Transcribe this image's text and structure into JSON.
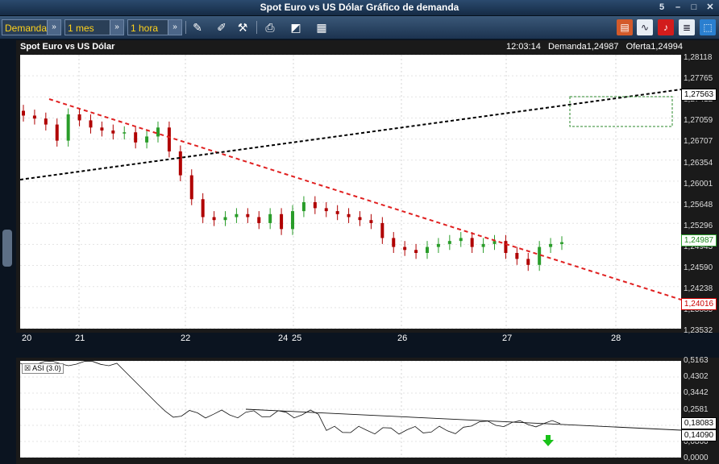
{
  "window": {
    "title": "Spot Euro vs US Dólar Gráfico de demanda",
    "controls": [
      "5",
      "–",
      "□",
      "✕"
    ]
  },
  "toolbar": {
    "price_select": "Demanda",
    "period_select": "1 mes",
    "interval_select": "1 hora"
  },
  "chart_header": {
    "title": "Spot Euro vs US Dólar",
    "time": "12:03:14",
    "bid_label": "Demanda",
    "bid": "1,24987",
    "ask_label": "Oferta",
    "ask": "1,24994"
  },
  "colors": {
    "up": "#2a9d2a",
    "down": "#b00000",
    "trend_red": "#e02020",
    "trend_black": "#000000",
    "zone_green": "#2b8a2b"
  },
  "price_axis": [
    "1,28118",
    "1,27765",
    "1,27412",
    "1,27059",
    "1,26707",
    "1,26354",
    "1,26001",
    "1,25648",
    "1,25296",
    "1,24943",
    "1,24590",
    "1,24238",
    "1,23885",
    "1,23532"
  ],
  "price_badges": {
    "black_line": "1,27563",
    "current": "1,24987",
    "red_line": "1,24016"
  },
  "x_axis": [
    "20",
    "21",
    "22",
    "24",
    "25",
    "26",
    "27",
    "28"
  ],
  "indicator": {
    "label": "ASI (3.0)",
    "axis": [
      "0,5163",
      "0,4302",
      "0,3442",
      "0,2581",
      "0,1721",
      "0,0860",
      "0,0000"
    ],
    "badges": [
      "0,18083",
      "0,14090"
    ]
  },
  "chart_data": {
    "type": "candlestick",
    "title": "Spot Euro vs US Dólar",
    "ylim": [
      1.23532,
      1.28118
    ],
    "x": [
      "20",
      "20",
      "20",
      "20",
      "20",
      "21",
      "21",
      "21",
      "21",
      "21",
      "21",
      "21",
      "21",
      "21",
      "21",
      "21",
      "22",
      "22",
      "22",
      "22",
      "22",
      "22",
      "22",
      "22",
      "22",
      "22",
      "24",
      "24",
      "24",
      "25",
      "25",
      "25",
      "25",
      "25",
      "25",
      "25",
      "26",
      "26",
      "26",
      "26",
      "26",
      "26",
      "26",
      "27",
      "27",
      "27",
      "27",
      "27",
      "27"
    ],
    "close": [
      1.271,
      1.2705,
      1.2695,
      1.2668,
      1.2712,
      1.2702,
      1.269,
      1.2685,
      1.268,
      1.2682,
      1.2665,
      1.2675,
      1.269,
      1.265,
      1.261,
      1.257,
      1.254,
      1.2535,
      1.254,
      1.2545,
      1.254,
      1.253,
      1.2545,
      1.252,
      1.255,
      1.2565,
      1.2555,
      1.255,
      1.2545,
      1.254,
      1.2535,
      1.253,
      1.2505,
      1.249,
      1.2485,
      1.248,
      1.249,
      1.2495,
      1.25,
      1.2505,
      1.249,
      1.2495,
      1.25,
      1.248,
      1.247,
      1.246,
      1.249,
      1.2495,
      1.2498
    ]
  }
}
